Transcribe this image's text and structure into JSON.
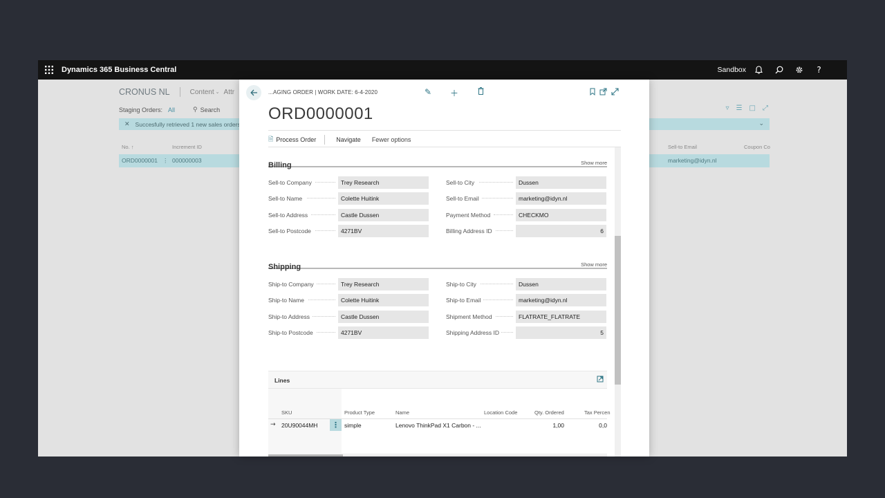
{
  "topbar": {
    "app_title": "Dynamics 365 Business Central",
    "environment": "Sandbox",
    "icons": [
      "waffle-icon",
      "bell-icon",
      "search-icon",
      "gear-icon",
      "help-icon"
    ],
    "help_glyph": "?"
  },
  "background_page": {
    "company": "CRONUS NL",
    "content_menu": "Content",
    "more_menu": "Attr",
    "list_label": "Staging Orders:",
    "filter_value": "All",
    "search_label": "Search",
    "notification": "Succesfully retrieved 1 new sales orders.",
    "columns": {
      "no": "No. ↑",
      "increment_id": "Increment ID",
      "sell_to_email": "Sell-to Email",
      "coupon_code": "Coupon Co"
    },
    "row": {
      "no": "ORD0000001",
      "increment_id": "000000003",
      "sell_to_email": "marketing@idyn.nl"
    }
  },
  "card": {
    "breadcrumb": "...AGING ORDER | WORK DATE: 6-4-2020",
    "title": "ORD0000001",
    "actions": {
      "process_order": "Process Order",
      "navigate": "Navigate",
      "fewer_options": "Fewer options"
    },
    "billing": {
      "title": "Billing",
      "show_more": "Show more",
      "fields": [
        {
          "label": "Sell-to Company",
          "value": "Trey Research"
        },
        {
          "label": "Sell-to Name",
          "value": "Colette Huitink"
        },
        {
          "label": "Sell-to Address",
          "value": "Castle Dussen"
        },
        {
          "label": "Sell-to Postcode",
          "value": "4271BV"
        },
        {
          "label": "Sell-to City",
          "value": "Dussen"
        },
        {
          "label": "Sell-to Email",
          "value": "marketing@idyn.nl"
        },
        {
          "label": "Payment Method",
          "value": "CHECKMO"
        },
        {
          "label": "Billing Address ID",
          "value": "6"
        }
      ]
    },
    "shipping": {
      "title": "Shipping",
      "show_more": "Show more",
      "fields": [
        {
          "label": "Ship-to Company",
          "value": "Trey Research"
        },
        {
          "label": "Ship-to Name",
          "value": "Colette Huitink"
        },
        {
          "label": "Ship-to Address",
          "value": "Castle Dussen"
        },
        {
          "label": "Ship-to Postcode",
          "value": "4271BV"
        },
        {
          "label": "Ship-to City",
          "value": "Dussen"
        },
        {
          "label": "Ship-to Email",
          "value": "marketing@idyn.nl"
        },
        {
          "label": "Shipment Method",
          "value": "FLATRATE_FLATRATE"
        },
        {
          "label": "Shipping Address ID",
          "value": "5"
        }
      ]
    },
    "lines": {
      "title": "Lines",
      "columns": [
        "SKU",
        "Product Type",
        "Name",
        "Location Code",
        "Qty. Ordered",
        "Tax Percen"
      ],
      "rows": [
        {
          "sku": "20U90044MH",
          "product_type": "simple",
          "name": "Lenovo ThinkPad X1 Carbon - ...",
          "location_code": "",
          "qty_ordered": "1,00",
          "tax_percent": "0,0"
        }
      ]
    }
  }
}
